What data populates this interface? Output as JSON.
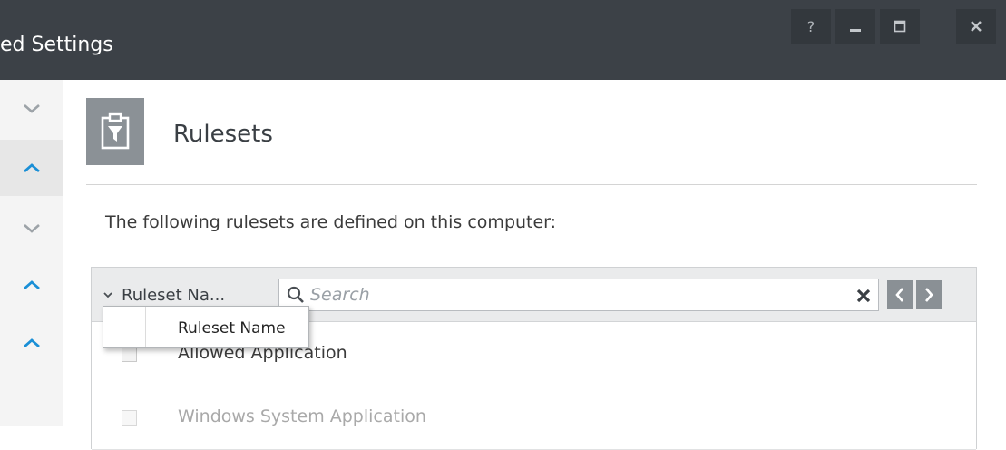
{
  "window": {
    "title": "ed Settings",
    "buttons": {
      "help": "?"
    }
  },
  "main": {
    "page_title": "Rulesets",
    "intro_text": "The following rulesets are defined on this computer:"
  },
  "table": {
    "column_selector_label": "Ruleset Na...",
    "search": {
      "placeholder": "Search",
      "value": ""
    },
    "rows": [
      {
        "name": "Allowed Application",
        "checked": false,
        "dimmed": false
      },
      {
        "name": "Windows System Application",
        "checked": false,
        "dimmed": true
      }
    ]
  },
  "column_dropdown": {
    "options": [
      "Ruleset Name"
    ]
  },
  "colors": {
    "titlebar": "#3c4147",
    "accent_chevron": "#1a8fd6",
    "icon_tile": "#8b9196"
  }
}
